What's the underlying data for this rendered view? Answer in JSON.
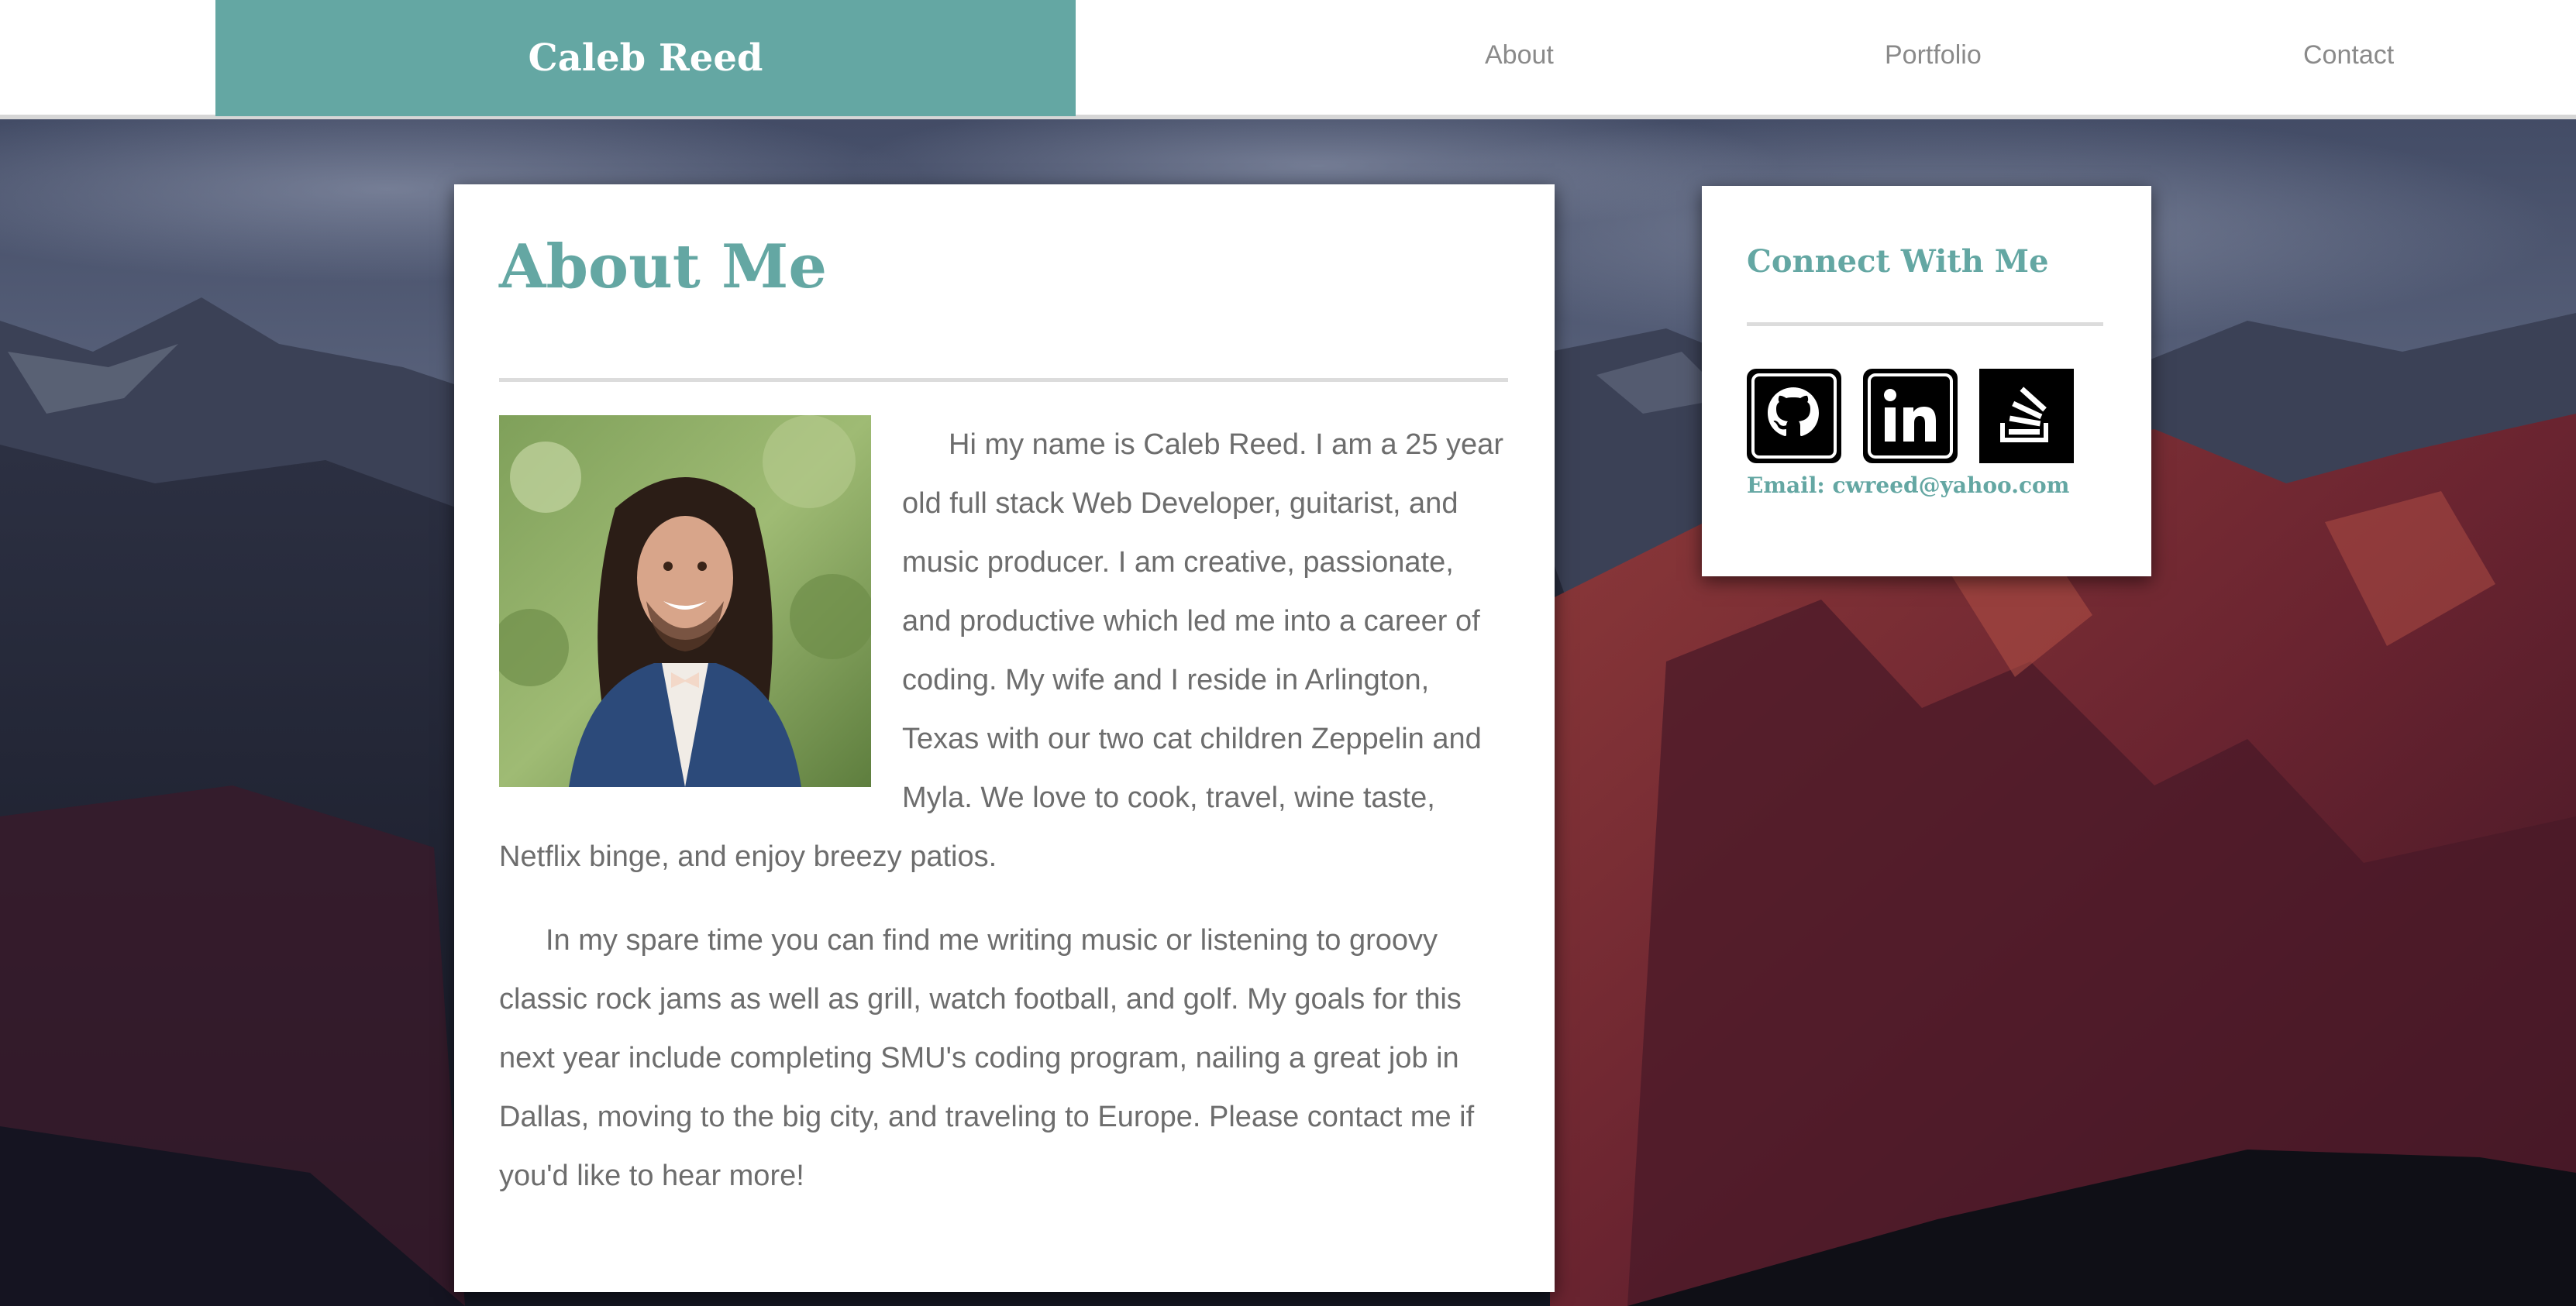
{
  "header": {
    "brand": "Caleb Reed",
    "nav": [
      {
        "label": "About"
      },
      {
        "label": "Portfolio"
      },
      {
        "label": "Contact"
      }
    ]
  },
  "about": {
    "title": "About Me",
    "paragraphs": [
      "Hi my name is Caleb Reed. I am a 25 year old full stack Web Developer, guitarist, and music producer. I am creative, passionate, and productive which led me into a career of coding. My wife and I reside in Arlington, Texas with our two cat children Zeppelin and Myla. We love to cook, travel, wine taste, Netflix binge, and enjoy breezy patios.",
      "In my spare time you can find me writing music or listening to groovy classic rock jams as well as grill, watch football, and golf. My goals for this next year include completing SMU's coding program, nailing a great job in Dallas, moving to the big city, and traveling to Europe. Please contact me if you'd like to hear more!"
    ]
  },
  "connect": {
    "title": "Connect With Me",
    "social_icons": [
      "github-icon",
      "linkedin-icon",
      "stackoverflow-icon"
    ],
    "email_label": "Email:",
    "email": "cwreed@yahoo.com"
  },
  "colors": {
    "accent": "#64a7a3",
    "nav_text": "#8a8a8a",
    "body_text": "#6d6d6d",
    "header_border": "#d6d6d6"
  }
}
